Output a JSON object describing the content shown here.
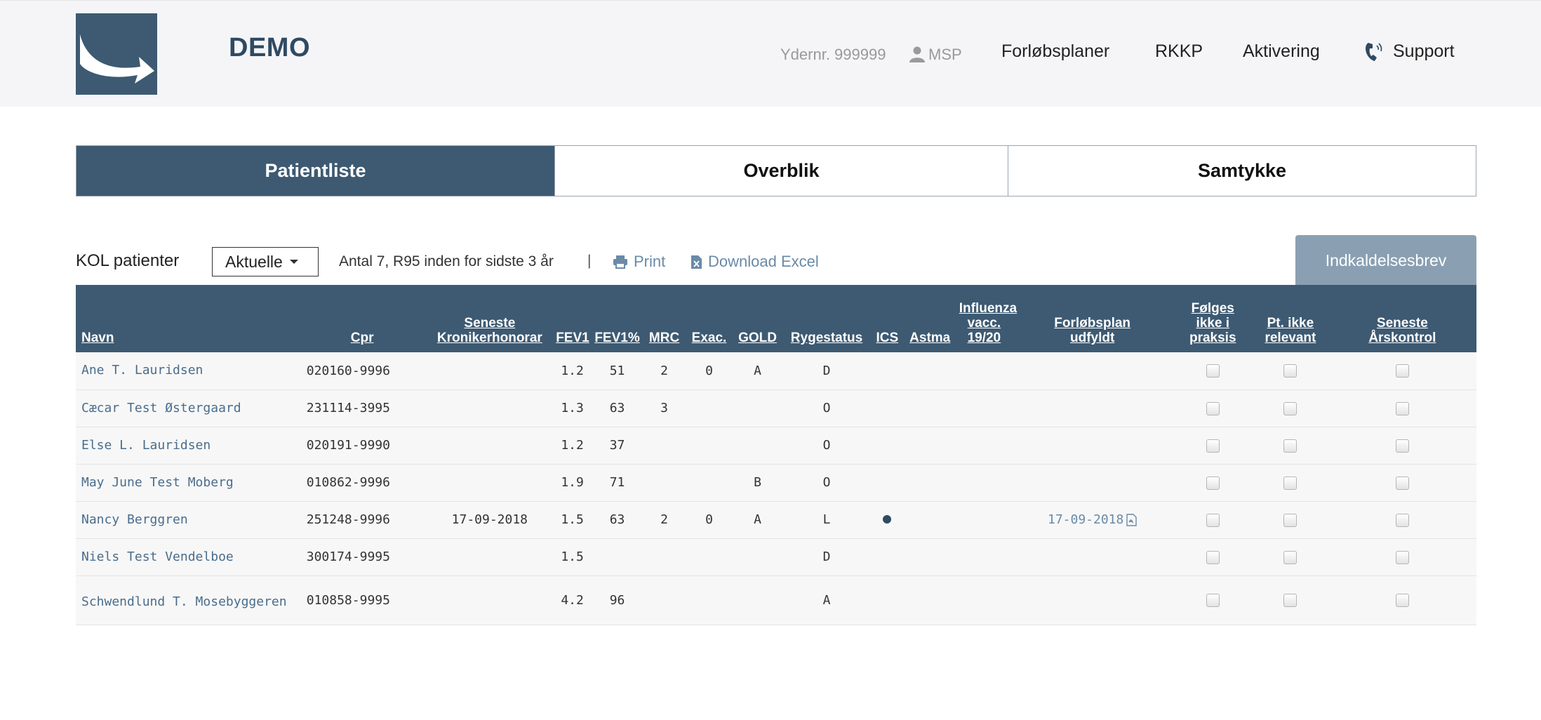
{
  "header": {
    "app_title": "DEMO",
    "ydernr": "Ydernr. 999999",
    "user": "MSP",
    "nav": [
      "Forløbsplaner",
      "RKKP",
      "Aktivering",
      "Support"
    ]
  },
  "tabs": [
    {
      "label": "Patientliste",
      "active": true
    },
    {
      "label": "Overblik",
      "active": false
    },
    {
      "label": "Samtykke",
      "active": false
    }
  ],
  "toolbar": {
    "list_label": "KOL patienter",
    "filter_value": "Aktuelle",
    "count_text": "Antal 7, R95 inden for sidste 3 år",
    "separator": "|",
    "print_label": "Print",
    "excel_label": "Download Excel",
    "letter_button": "Indkaldelsesbrev"
  },
  "table": {
    "headers": {
      "navn": "Navn",
      "cpr": "Cpr",
      "kronik_1": "Seneste",
      "kronik_2": "Kronikerhonorar",
      "fev1": "FEV1",
      "fev1pct": "FEV1%",
      "mrc": "MRC",
      "exac": "Exac.",
      "gold": "GOLD",
      "ryge": "Rygestatus",
      "ics": "ICS",
      "astma": "Astma",
      "influenza_1": "Influenza",
      "influenza_2": "vacc.",
      "influenza_3": "19/20",
      "forlob_1": "Forløbsplan",
      "forlob_2": "udfyldt",
      "folges_1": "Følges",
      "folges_2": "ikke i",
      "folges_3": "praksis",
      "ptikke_1": "Pt. ikke",
      "ptikke_2": "relevant",
      "aars_1": "Seneste",
      "aars_2": "Årskontrol"
    },
    "rows": [
      {
        "navn": "Ane T. Lauridsen",
        "cpr": "020160-9996",
        "kronik": "",
        "fev1": "1.2",
        "fev1pct": "51",
        "mrc": "2",
        "exac": "0",
        "gold": "A",
        "ryge": "D",
        "ics": false,
        "forlob": ""
      },
      {
        "navn": "Cæcar Test Østergaard",
        "cpr": "231114-3995",
        "kronik": "",
        "fev1": "1.3",
        "fev1pct": "63",
        "mrc": "3",
        "exac": "",
        "gold": "",
        "ryge": "O",
        "ics": false,
        "forlob": ""
      },
      {
        "navn": "Else L. Lauridsen",
        "cpr": "020191-9990",
        "kronik": "",
        "fev1": "1.2",
        "fev1pct": "37",
        "mrc": "",
        "exac": "",
        "gold": "",
        "ryge": "O",
        "ics": false,
        "forlob": ""
      },
      {
        "navn": "May June Test Moberg",
        "cpr": "010862-9996",
        "kronik": "",
        "fev1": "1.9",
        "fev1pct": "71",
        "mrc": "",
        "exac": "",
        "gold": "B",
        "ryge": "O",
        "ics": false,
        "forlob": ""
      },
      {
        "navn": "Nancy Berggren",
        "cpr": "251248-9996",
        "kronik": "17-09-2018",
        "fev1": "1.5",
        "fev1pct": "63",
        "mrc": "2",
        "exac": "0",
        "gold": "A",
        "ryge": "L",
        "ics": true,
        "forlob": "17-09-2018"
      },
      {
        "navn": "Niels Test Vendelboe",
        "cpr": "300174-9995",
        "kronik": "",
        "fev1": "1.5",
        "fev1pct": "",
        "mrc": "",
        "exac": "",
        "gold": "",
        "ryge": "D",
        "ics": false,
        "forlob": ""
      },
      {
        "navn": "Schwendlund T. Mosebyggeren",
        "cpr": "010858-9995",
        "kronik": "",
        "fev1": "4.2",
        "fev1pct": "96",
        "mrc": "",
        "exac": "",
        "gold": "",
        "ryge": "A",
        "ics": false,
        "forlob": ""
      }
    ]
  },
  "colors": {
    "primary": "#3d5a72",
    "header_bg": "#f5f5f8",
    "link": "#6a8aa8",
    "button_disabled": "#8aa0b2"
  }
}
